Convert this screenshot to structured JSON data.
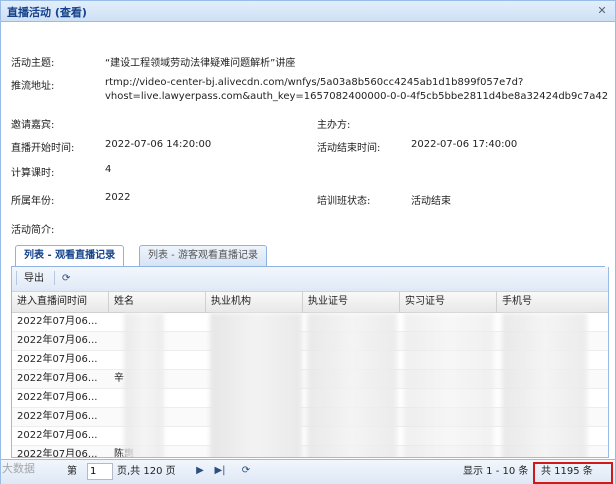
{
  "window": {
    "title": "直播活动 (查看)"
  },
  "fields": {
    "topic_label": "活动主题:",
    "topic_value": "“建设工程领域劳动法律疑难问题解析”讲座",
    "stream_label": "推流地址:",
    "stream_line1": "rtmp://video-center-bj.alivecdn.com/wnfys/5a03a8b560cc4245ab1d1b899f057e7d?",
    "stream_line2": "vhost=live.lawyerpass.com&auth_key=1657082400000-0-0-4f5cb5bbe2811d4be8a32424db9c7a42",
    "guest_label": "邀请嘉宾:",
    "host_label": "主办方:",
    "start_label": "直播开始时间:",
    "start_value": "2022-07-06 14:20:00",
    "end_label": "活动结束时间:",
    "end_value": "2022-07-06 17:40:00",
    "hours_label": "计算课时:",
    "hours_value": "4",
    "year_label": "所属年份:",
    "year_value": "2022",
    "status_label": "培训班状态:",
    "status_value": "活动结束",
    "intro_label": "活动简介:"
  },
  "tabs": [
    {
      "label": "列表 - 观看直播记录",
      "active": true
    },
    {
      "label": "列表 - 游客观看直播记录",
      "active": false
    }
  ],
  "toolbar": {
    "export_label": "导出",
    "refresh_icon": "refresh-icon"
  },
  "columns": [
    "进入直播间时间",
    "姓名",
    "执业机构",
    "执业证号",
    "实习证号",
    "手机号"
  ],
  "rows": [
    {
      "time": "2022年07月06...",
      "name": ""
    },
    {
      "time": "2022年07月06...",
      "name": ""
    },
    {
      "time": "2022年07月06...",
      "name": ""
    },
    {
      "time": "2022年07月06...",
      "name": "辛"
    },
    {
      "time": "2022年07月06...",
      "name": ""
    },
    {
      "time": "2022年07月06...",
      "name": ""
    },
    {
      "time": "2022年07月06...",
      "name": ""
    },
    {
      "time": "2022年07月06...",
      "name": "陈惠"
    }
  ],
  "pager": {
    "page_prefix": "第",
    "page_value": "1",
    "page_suffix": "页,共 120 页",
    "display_text": "显示 1 - 10 条",
    "total_text": "共 1195 条"
  },
  "watermark": "大数据"
}
